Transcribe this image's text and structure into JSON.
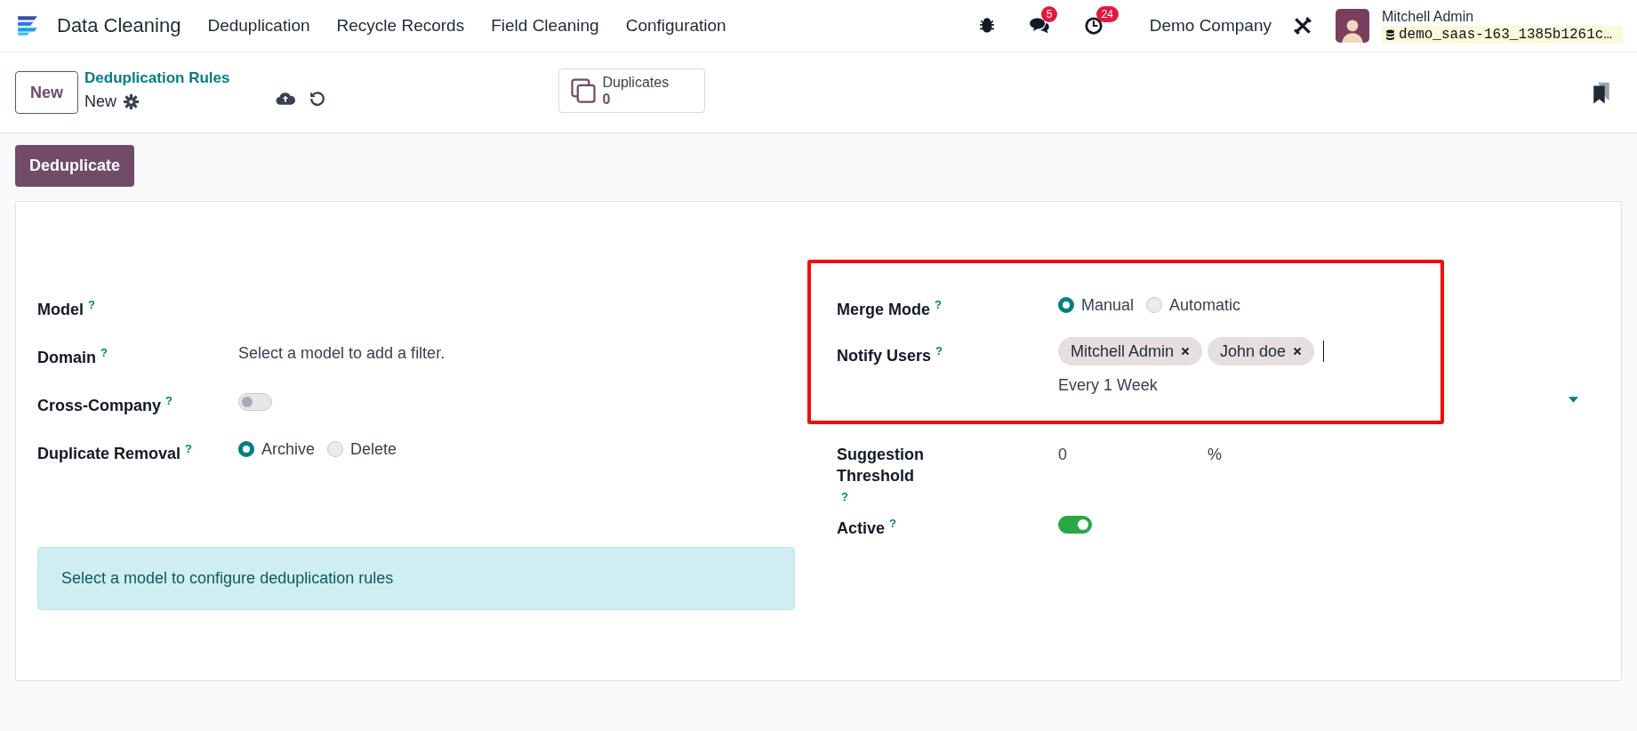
{
  "navbar": {
    "app_name": "Data Cleaning",
    "menu": [
      "Deduplication",
      "Recycle Records",
      "Field Cleaning",
      "Configuration"
    ],
    "chat_badge": "5",
    "activity_badge": "24",
    "company": "Demo Company",
    "user_name": "Mitchell Admin",
    "database": "demo_saas-163_1385b1261c…"
  },
  "control_panel": {
    "new_button": "New",
    "breadcrumb": "Deduplication Rules",
    "record": "New",
    "smart_button": {
      "label": "Duplicates",
      "value": "0"
    }
  },
  "action_button": "Deduplicate",
  "left_fields": [
    {
      "kind": "empty",
      "label": "Model",
      "help": "?"
    },
    {
      "kind": "text",
      "label": "Domain",
      "help": "?",
      "value": "Select a model to add a filter."
    },
    {
      "kind": "toggle",
      "label": "Cross-Company",
      "help": "?",
      "on": false
    },
    {
      "kind": "radio",
      "label": "Duplicate Removal",
      "help": "?",
      "options": [
        {
          "label": "Archive",
          "selected": true
        },
        {
          "label": "Delete",
          "selected": false
        }
      ]
    }
  ],
  "right_sections": [
    {
      "highlighted": true,
      "fields": [
        {
          "kind": "radio",
          "label": "Merge Mode",
          "help": "?",
          "options": [
            {
              "label": "Manual",
              "selected": true
            },
            {
              "label": "Automatic",
              "selected": false
            }
          ]
        },
        {
          "kind": "tags",
          "label": "Notify Users",
          "help": "?",
          "tags": [
            "Mitchell Admin",
            "John doe"
          ],
          "note": "Every 1 Week"
        }
      ]
    },
    {
      "highlighted": false,
      "fields": [
        {
          "kind": "percent",
          "label": "Suggestion Threshold",
          "help": "?",
          "value": "0",
          "unit": "%"
        },
        {
          "kind": "toggle",
          "label": "Active",
          "help": "?",
          "on": true
        }
      ]
    }
  ],
  "alert": "Select a model to configure deduplication rules"
}
